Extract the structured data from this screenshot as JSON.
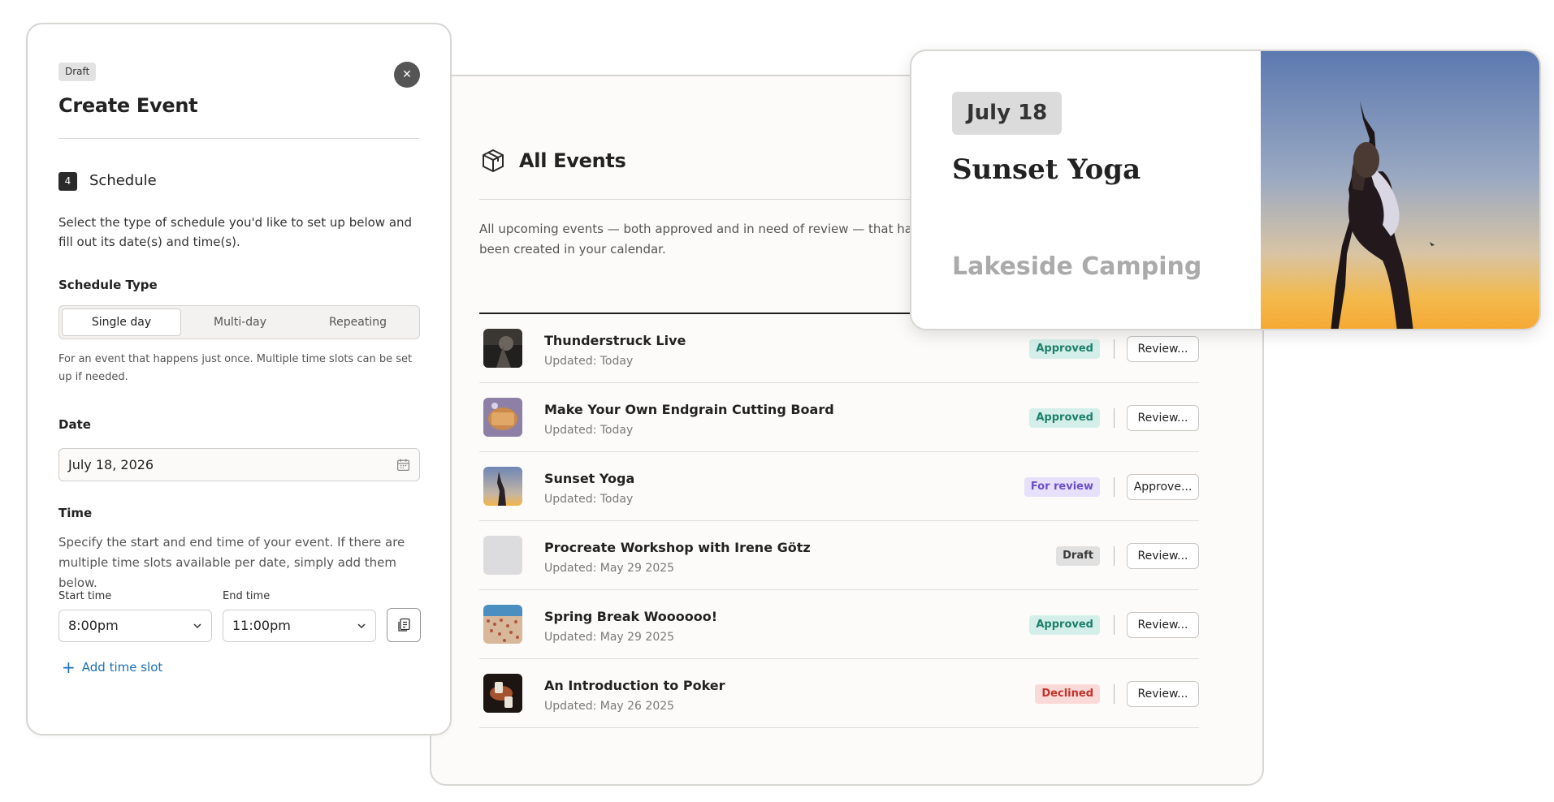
{
  "events_panel": {
    "title": "All Events",
    "header_icon": "box-icon",
    "description": "All upcoming events —  both approved and in need of review — that have been created in your calendar.",
    "events": [
      {
        "name": "Thunderstruck Live",
        "updated": "Updated: Today",
        "status": "Approved",
        "action": "Review...",
        "thumb": "concert-photo"
      },
      {
        "name": "Make Your Own Endgrain Cutting Board",
        "updated": "Updated: Today",
        "status": "Approved",
        "action": "Review...",
        "thumb": "cutting-board-photo"
      },
      {
        "name": "Sunset Yoga",
        "updated": "Updated: Today",
        "status": "For review",
        "action": "Approve...",
        "thumb": "yoga-photo"
      },
      {
        "name": "Procreate Workshop with Irene Götz",
        "updated": "Updated: May 29 2025",
        "status": "Draft",
        "action": "Review...",
        "thumb": "blank"
      },
      {
        "name": "Spring Break Woooooo!",
        "updated": "Updated: May 29 2025",
        "status": "Approved",
        "action": "Review...",
        "thumb": "beach-photo"
      },
      {
        "name": "An Introduction to Poker",
        "updated": "Updated: May 26 2025",
        "status": "Declined",
        "action": "Review...",
        "thumb": "poker-photo"
      }
    ]
  },
  "modal": {
    "status_chip": "Draft",
    "close_icon": "close-icon",
    "title": "Create Event",
    "step_number": "4",
    "step_title": "Schedule",
    "step_description": "Select the type of schedule you'd like to set up below and fill out its date(s) and time(s).",
    "schedule_type_label": "Schedule Type",
    "schedule_options": [
      "Single day",
      "Multi-day",
      "Repeating"
    ],
    "selected_schedule": "Single day",
    "schedule_hint": "For an event that happens just once. Multiple time slots can be set up if needed.",
    "date_label": "Date",
    "date_value": "July 18, 2026",
    "time_label": "Time",
    "time_description": "Specify the start and end time of your event. If there are multiple time slots available per date, simply add them below.",
    "start_time_label": "Start time",
    "start_time_value": "8:00pm",
    "end_time_label": "End time",
    "end_time_value": "11:00pm",
    "add_slot_label": "Add time slot"
  },
  "preview": {
    "date": "July 18",
    "title": "Sunset Yoga",
    "next_title": "Lakeside Camping"
  },
  "colors": {
    "approved_bg": "#d4efea",
    "approved_fg": "#1e7f6b",
    "review_bg": "#e6e0fa",
    "review_fg": "#6d4fc9",
    "draft_bg": "#e1e0e0",
    "declined_bg": "#fadad8",
    "declined_fg": "#c3322a",
    "link": "#1b6fb5"
  }
}
